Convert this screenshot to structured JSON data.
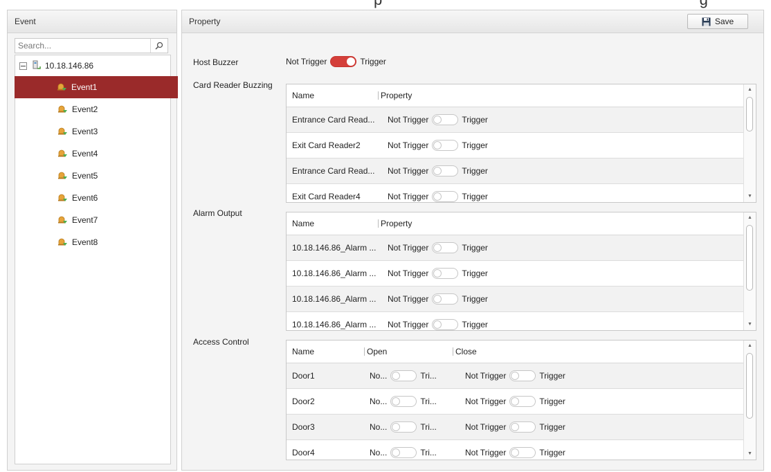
{
  "left_panel": {
    "title": "Event",
    "search_placeholder": "Search...",
    "root_label": "10.18.146.86",
    "events": [
      "Event1",
      "Event2",
      "Event3",
      "Event4",
      "Event5",
      "Event6",
      "Event7",
      "Event8"
    ],
    "selected_event": "Event1"
  },
  "right_panel": {
    "title": "Property",
    "save_label": "Save"
  },
  "host_buzzer": {
    "label": "Host Buzzer",
    "off_label": "Not Trigger",
    "on_label": "Trigger",
    "state": "on"
  },
  "card_reader": {
    "label": "Card Reader Buzzing",
    "col_name": "Name",
    "col_property": "Property",
    "rows": [
      {
        "name": "Entrance Card Read...",
        "off": "Not Trigger",
        "on": "Trigger"
      },
      {
        "name": "Exit Card Reader2",
        "off": "Not Trigger",
        "on": "Trigger"
      },
      {
        "name": "Entrance Card Read...",
        "off": "Not Trigger",
        "on": "Trigger"
      },
      {
        "name": "Exit Card Reader4",
        "off": "Not Trigger",
        "on": "Trigger"
      }
    ]
  },
  "alarm_output": {
    "label": "Alarm Output",
    "col_name": "Name",
    "col_property": "Property",
    "rows": [
      {
        "name": "10.18.146.86_Alarm ...",
        "off": "Not Trigger",
        "on": "Trigger"
      },
      {
        "name": "10.18.146.86_Alarm ...",
        "off": "Not Trigger",
        "on": "Trigger"
      },
      {
        "name": "10.18.146.86_Alarm ...",
        "off": "Not Trigger",
        "on": "Trigger"
      },
      {
        "name": "10.18.146.86_Alarm ...",
        "off": "Not Trigger",
        "on": "Trigger"
      }
    ]
  },
  "access_control": {
    "label": "Access Control",
    "col_name": "Name",
    "col_open": "Open",
    "col_close": "Close",
    "rows": [
      {
        "name": "Door1",
        "open_off": "No...",
        "open_on": "Tri...",
        "close_off": "Not Trigger",
        "close_on": "Trigger"
      },
      {
        "name": "Door2",
        "open_off": "No...",
        "open_on": "Tri...",
        "close_off": "Not Trigger",
        "close_on": "Trigger"
      },
      {
        "name": "Door3",
        "open_off": "No...",
        "open_on": "Tri...",
        "close_off": "Not Trigger",
        "close_on": "Trigger"
      },
      {
        "name": "Door4",
        "open_off": "No...",
        "open_on": "Tri...",
        "close_off": "Not Trigger",
        "close_on": "Trigger"
      }
    ]
  },
  "colors": {
    "accent_red": "#d43f3a",
    "selected_row": "#9a2a2a"
  }
}
